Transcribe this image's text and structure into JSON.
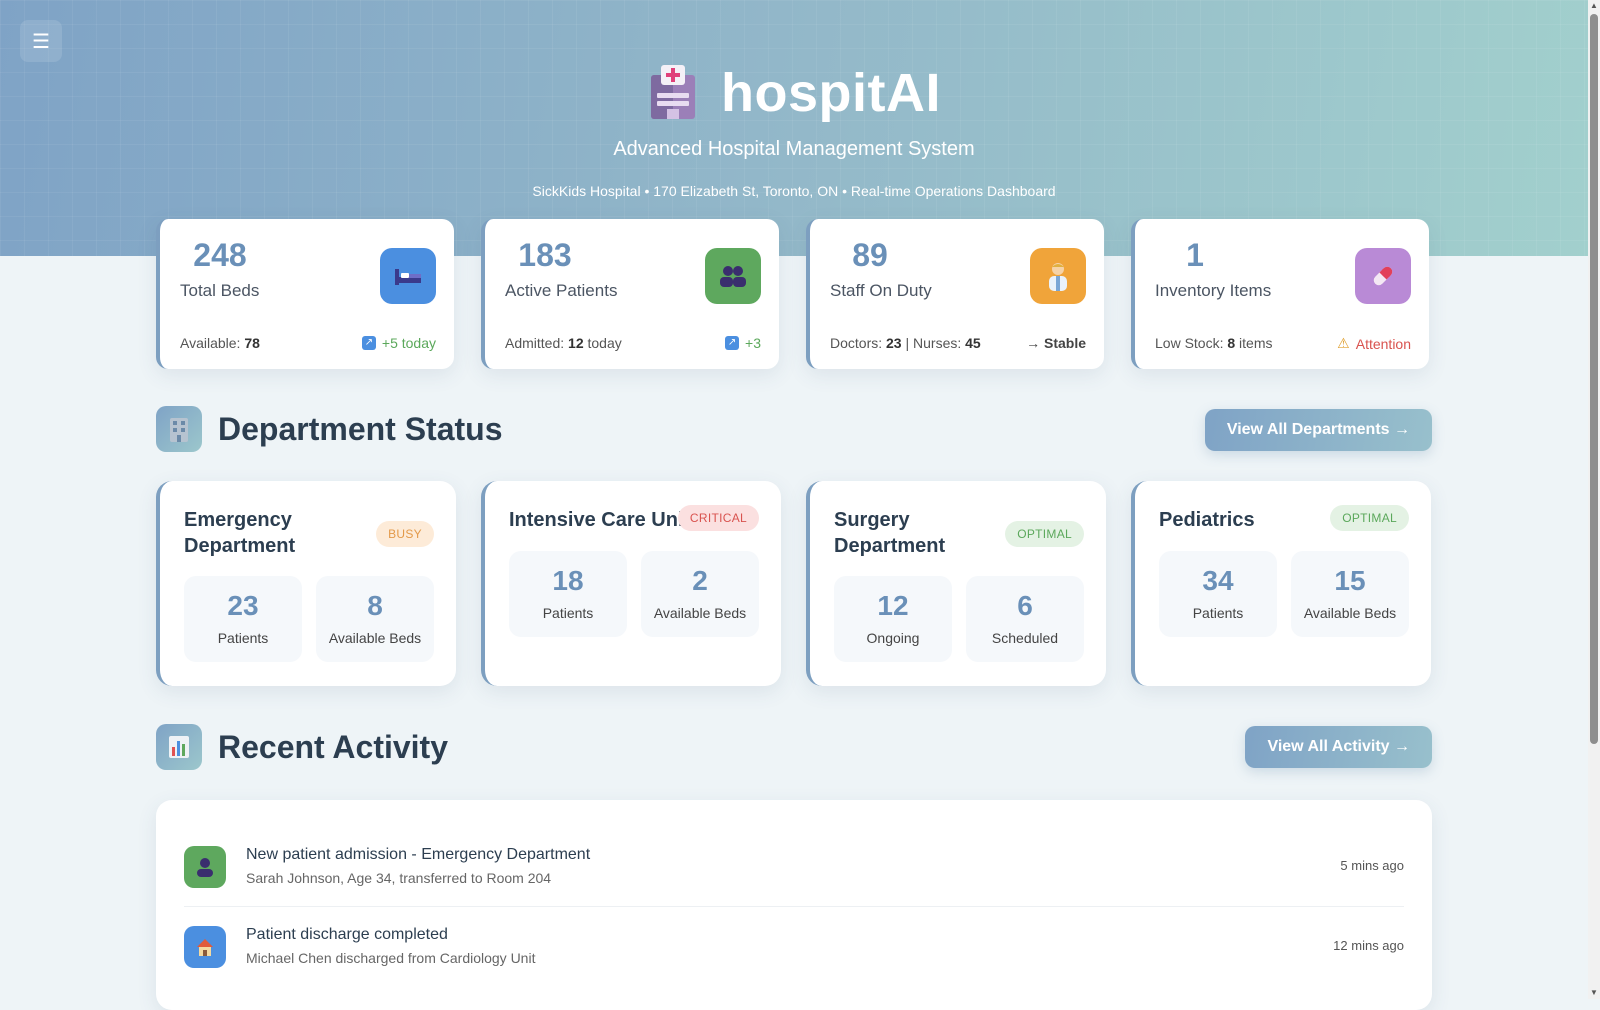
{
  "header": {
    "menu_icon": "☰",
    "brand_icon": "hospital-icon",
    "title": "hospitAI",
    "subtitle": "Advanced Hospital Management System",
    "address": "SickKids Hospital • 170 Elizabeth St, Toronto, ON • Real-time Operations Dashboard"
  },
  "stats": [
    {
      "value": "248",
      "label": "Total Beds",
      "icon": "bed-icon",
      "icon_color": "#4b8fe0",
      "foot_label": "Available: ",
      "foot_value": "78",
      "foot_suffix": "",
      "trend": "+5 today",
      "trend_color": "#5ba85b",
      "trend_icon": "↗"
    },
    {
      "value": "183",
      "label": "Active Patients",
      "icon": "patients-icon",
      "icon_color": "#5ea85e",
      "foot_label": "Admitted: ",
      "foot_value": "12",
      "foot_suffix": " today",
      "trend": "+3",
      "trend_color": "#5ba85b",
      "trend_icon": "↗"
    },
    {
      "value": "89",
      "label": "Staff On Duty",
      "icon": "doctor-icon",
      "icon_color": "#f0a43a",
      "foot_label": "Doctors: ",
      "foot_value": "23",
      "foot_mid": " | Nurses: ",
      "foot_value2": "45",
      "trend": "→ Stable",
      "trend_color": "#444"
    },
    {
      "value": "1",
      "label": "Inventory Items",
      "icon": "pill-icon",
      "icon_color": "#b98ad6",
      "foot_label": "Low Stock: ",
      "foot_value": "8",
      "foot_suffix": " items",
      "trend": "Attention",
      "trend_color": "#d9534f",
      "trend_icon": "⚠"
    }
  ],
  "departments_section": {
    "icon": "building-icon",
    "title": "Department Status",
    "button": "View All Departments →"
  },
  "departments": [
    {
      "name": "Emergency Department",
      "badge": "BUSY",
      "status": "busy",
      "stats": [
        {
          "value": "23",
          "label": "Patients"
        },
        {
          "value": "8",
          "label": "Available Beds"
        }
      ]
    },
    {
      "name": "Intensive Care Unit",
      "badge": "CRITICAL",
      "status": "critical",
      "stats": [
        {
          "value": "18",
          "label": "Patients"
        },
        {
          "value": "2",
          "label": "Available Beds"
        }
      ]
    },
    {
      "name": "Surgery Department",
      "badge": "OPTIMAL",
      "status": "optimal",
      "stats": [
        {
          "value": "12",
          "label": "Ongoing"
        },
        {
          "value": "6",
          "label": "Scheduled"
        }
      ]
    },
    {
      "name": "Pediatrics",
      "badge": "OPTIMAL",
      "status": "optimal",
      "stats": [
        {
          "value": "34",
          "label": "Patients"
        },
        {
          "value": "15",
          "label": "Available Beds"
        }
      ]
    }
  ],
  "activity_section": {
    "icon": "bar-chart-icon",
    "title": "Recent Activity",
    "button": "View All Activity →"
  },
  "activities": [
    {
      "icon": "person-icon",
      "icon_color": "#5ea85e",
      "title": "New patient admission - Emergency Department",
      "desc": "Sarah Johnson, Age 34, transferred to Room 204",
      "time": "5 mins ago"
    },
    {
      "icon": "house-icon",
      "icon_color": "#4b8fe0",
      "title": "Patient discharge completed",
      "desc": "Michael Chen discharged from Cardiology Unit",
      "time": "12 mins ago"
    }
  ]
}
